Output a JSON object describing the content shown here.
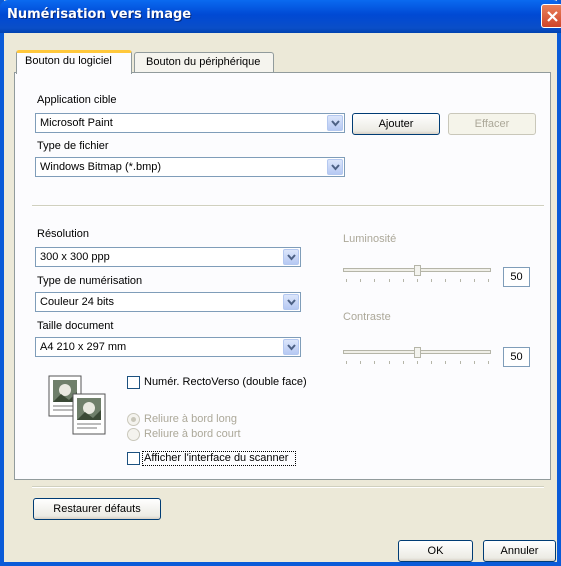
{
  "window": {
    "title": "Numérisation vers image"
  },
  "tabs": [
    {
      "label": "Bouton du logiciel"
    },
    {
      "label": "Bouton du périphérique"
    }
  ],
  "target_app": {
    "label": "Application cible",
    "value": "Microsoft Paint",
    "add_label": "Ajouter",
    "delete_label": "Effacer"
  },
  "file_type": {
    "label": "Type de fichier",
    "value": "Windows Bitmap (*.bmp)"
  },
  "resolution": {
    "label": "Résolution",
    "value": "300 x 300 ppp"
  },
  "scan_type": {
    "label": "Type de numérisation",
    "value": "Couleur 24 bits"
  },
  "doc_size": {
    "label": "Taille document",
    "value": "A4 210 x 297 mm"
  },
  "brightness": {
    "label": "Luminosité",
    "value": "50",
    "level": 0.5
  },
  "contrast": {
    "label": "Contraste",
    "value": "50",
    "level": 0.5
  },
  "duplex": {
    "label": "Numér. RectoVerso (double face)"
  },
  "binding": {
    "long_edge": "Reliure à bord long",
    "short_edge": "Reliure à bord court"
  },
  "show_scanner_ui": {
    "label": "Afficher l'interface du scanner"
  },
  "restore_defaults": "Restaurer défauts",
  "ok": "OK",
  "cancel": "Annuler",
  "colors": {
    "titlebar": "#0a5bd8",
    "close": "#d0442a",
    "dialog_bg": "#ece9d8",
    "tab_highlight": "#ffc83c"
  }
}
